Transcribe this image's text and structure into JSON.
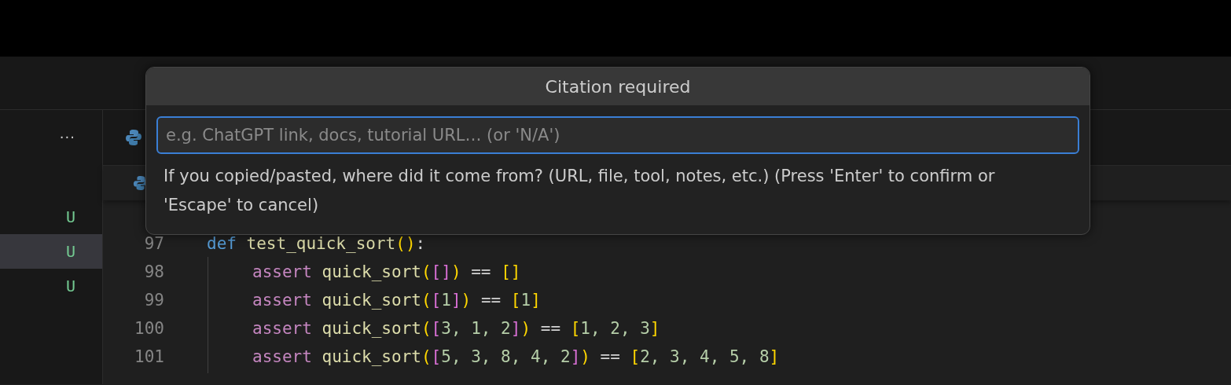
{
  "sidebar": {
    "more": "···",
    "items": [
      {
        "status": "U",
        "selected": false
      },
      {
        "status": "U",
        "selected": true
      },
      {
        "status": "U",
        "selected": false
      }
    ]
  },
  "dialog": {
    "title": "Citation required",
    "placeholder": "e.g. ChatGPT link, docs, tutorial URL… (or 'N/A')",
    "help": "If you copied/pasted, where did it come from? (URL, file, tool, notes, etc.) (Press 'Enter' to confirm or 'Escape' to cancel)"
  },
  "code": [
    {
      "number": "97",
      "indented": false,
      "tokens": [
        {
          "text": "def ",
          "kind": "keyword"
        },
        {
          "text": "test_quick_sort",
          "kind": "function"
        },
        {
          "text": "()",
          "kind": "bracket1"
        },
        {
          "text": ":",
          "kind": "plain"
        }
      ]
    },
    {
      "number": "98",
      "indented": true,
      "tokens": [
        {
          "text": "assert ",
          "kind": "control"
        },
        {
          "text": "quick_sort",
          "kind": "function"
        },
        {
          "text": "(",
          "kind": "bracket1"
        },
        {
          "text": "[]",
          "kind": "bracket2"
        },
        {
          "text": ")",
          "kind": "bracket1"
        },
        {
          "text": " == ",
          "kind": "plain"
        },
        {
          "text": "[]",
          "kind": "bracket1"
        }
      ]
    },
    {
      "number": "99",
      "indented": true,
      "tokens": [
        {
          "text": "assert ",
          "kind": "control"
        },
        {
          "text": "quick_sort",
          "kind": "function"
        },
        {
          "text": "(",
          "kind": "bracket1"
        },
        {
          "text": "[",
          "kind": "bracket2"
        },
        {
          "text": "1",
          "kind": "number"
        },
        {
          "text": "]",
          "kind": "bracket2"
        },
        {
          "text": ")",
          "kind": "bracket1"
        },
        {
          "text": " == ",
          "kind": "plain"
        },
        {
          "text": "[",
          "kind": "bracket1"
        },
        {
          "text": "1",
          "kind": "number"
        },
        {
          "text": "]",
          "kind": "bracket1"
        }
      ]
    },
    {
      "number": "100",
      "indented": true,
      "tokens": [
        {
          "text": "assert ",
          "kind": "control"
        },
        {
          "text": "quick_sort",
          "kind": "function"
        },
        {
          "text": "(",
          "kind": "bracket1"
        },
        {
          "text": "[",
          "kind": "bracket2"
        },
        {
          "text": "3, 1, 2",
          "kind": "number"
        },
        {
          "text": "]",
          "kind": "bracket2"
        },
        {
          "text": ")",
          "kind": "bracket1"
        },
        {
          "text": " == ",
          "kind": "plain"
        },
        {
          "text": "[",
          "kind": "bracket1"
        },
        {
          "text": "1, 2, 3",
          "kind": "number"
        },
        {
          "text": "]",
          "kind": "bracket1"
        }
      ]
    },
    {
      "number": "101",
      "indented": true,
      "tokens": [
        {
          "text": "assert ",
          "kind": "control"
        },
        {
          "text": "quick_sort",
          "kind": "function"
        },
        {
          "text": "(",
          "kind": "bracket1"
        },
        {
          "text": "[",
          "kind": "bracket2"
        },
        {
          "text": "5, 3, 8, 4, 2",
          "kind": "number"
        },
        {
          "text": "]",
          "kind": "bracket2"
        },
        {
          "text": ")",
          "kind": "bracket1"
        },
        {
          "text": " == ",
          "kind": "plain"
        },
        {
          "text": "[",
          "kind": "bracket1"
        },
        {
          "text": "2, 3, 4, 5, 8",
          "kind": "number"
        },
        {
          "text": "]",
          "kind": "bracket1"
        }
      ]
    }
  ]
}
